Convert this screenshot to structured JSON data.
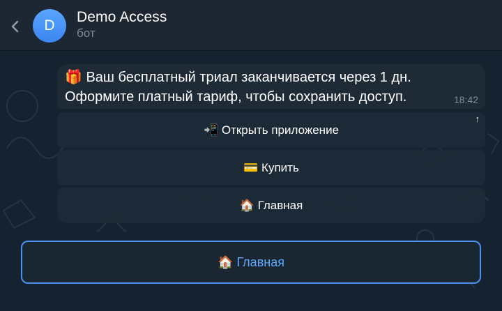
{
  "header": {
    "back_icon": "chevron-left-icon",
    "avatar_letter": "D",
    "avatar_color": "#4a95fa",
    "title": "Demo Access",
    "subtitle": "бот"
  },
  "message": {
    "text": "🎁 Ваш бесплатный триал заканчивается через 1 дн.\nОформите платный тариф, чтобы сохранить доступ.",
    "time": "18:42"
  },
  "inline_buttons": [
    {
      "label": "📲 Открыть приложение",
      "corner_icon": "↑"
    },
    {
      "label": "💳 Купить"
    },
    {
      "label": "🏠 Главная"
    }
  ],
  "reply_keyboard": {
    "button_label": "🏠 Главная",
    "accent_color": "#4a91f0"
  }
}
